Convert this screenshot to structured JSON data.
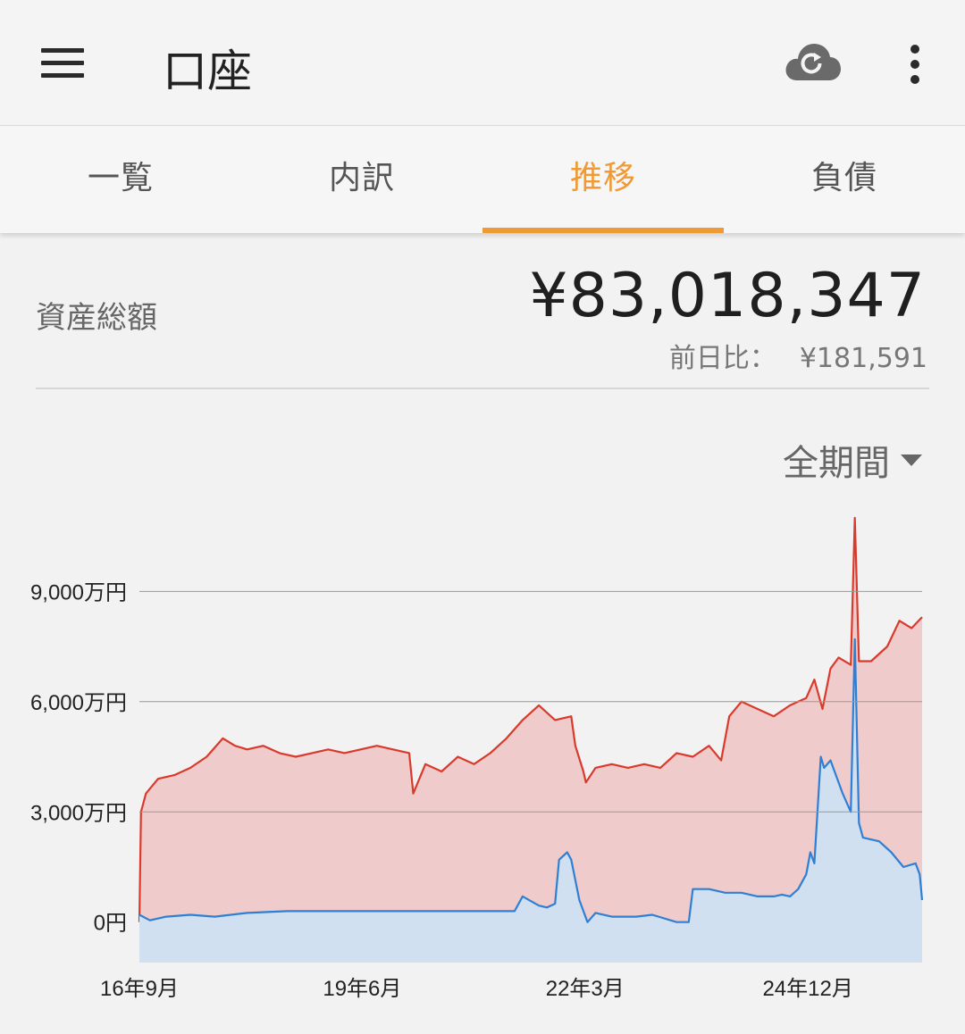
{
  "app_bar": {
    "title": "口座",
    "menu_icon": "hamburger-menu-icon",
    "sync_icon": "cloud-sync-icon",
    "more_icon": "more-vertical-icon"
  },
  "tabs": [
    {
      "label": "一覧",
      "active": false
    },
    {
      "label": "内訳",
      "active": false
    },
    {
      "label": "推移",
      "active": true
    },
    {
      "label": "負債",
      "active": false
    }
  ],
  "summary": {
    "total_label": "資産総額",
    "total_value": "¥83,018,347",
    "diff_label": "前日比：",
    "diff_value": "¥181,591"
  },
  "period": {
    "selected": "全期間"
  },
  "colors": {
    "accent": "#f09a36",
    "total_line": "#d93a2b",
    "total_fill": "#f0cbcb",
    "sub_line": "#2f7fd4",
    "sub_fill": "#d1e0f1"
  },
  "chart_data": {
    "type": "area",
    "ylabels": [
      "9,000万円",
      "6,000万円",
      "3,000万円",
      "0円"
    ],
    "yticks": [
      9000,
      6000,
      3000,
      0
    ],
    "ylim": [
      -1100,
      11000
    ],
    "xlabels": [
      "16年9月",
      "19年6月",
      "22年3月",
      "24年12月"
    ],
    "xticks": [
      2016.67,
      2019.42,
      2022.17,
      2024.92
    ],
    "xlim": [
      2016.67,
      2026.33
    ],
    "grid": true,
    "series": [
      {
        "key": "total",
        "x": [
          2016.67,
          2016.69,
          2016.75,
          2016.9,
          2017.1,
          2017.3,
          2017.5,
          2017.7,
          2017.85,
          2018.0,
          2018.2,
          2018.4,
          2018.6,
          2018.8,
          2019.0,
          2019.2,
          2019.4,
          2019.6,
          2019.8,
          2020.0,
          2020.05,
          2020.2,
          2020.4,
          2020.6,
          2020.8,
          2021.0,
          2021.2,
          2021.4,
          2021.6,
          2021.8,
          2022.0,
          2022.05,
          2022.15,
          2022.18,
          2022.3,
          2022.5,
          2022.7,
          2022.9,
          2023.1,
          2023.3,
          2023.5,
          2023.7,
          2023.85,
          2023.95,
          2024.1,
          2024.3,
          2024.5,
          2024.7,
          2024.9,
          2025.0,
          2025.1,
          2025.2,
          2025.3,
          2025.45,
          2025.5,
          2025.55,
          2025.7,
          2025.9,
          2026.05,
          2026.2,
          2026.33
        ],
        "y": [
          0,
          3000,
          3500,
          3900,
          4000,
          4200,
          4500,
          5000,
          4800,
          4700,
          4800,
          4600,
          4500,
          4600,
          4700,
          4600,
          4700,
          4800,
          4700,
          4600,
          3500,
          4300,
          4100,
          4500,
          4300,
          4600,
          5000,
          5500,
          5900,
          5500,
          5600,
          4800,
          4100,
          3800,
          4200,
          4300,
          4200,
          4300,
          4200,
          4600,
          4500,
          4800,
          4400,
          5600,
          6000,
          5800,
          5600,
          5900,
          6100,
          6600,
          5800,
          6900,
          7200,
          7000,
          11000,
          7100,
          7100,
          7500,
          8200,
          8000,
          8300
        ]
      },
      {
        "key": "sub",
        "x": [
          2016.67,
          2016.8,
          2017.0,
          2017.3,
          2017.6,
          2018.0,
          2018.5,
          2019.0,
          2019.5,
          2020.0,
          2020.5,
          2021.0,
          2021.3,
          2021.4,
          2021.6,
          2021.7,
          2021.8,
          2021.85,
          2021.95,
          2022.0,
          2022.1,
          2022.2,
          2022.3,
          2022.5,
          2022.8,
          2023.0,
          2023.3,
          2023.45,
          2023.5,
          2023.7,
          2023.9,
          2024.1,
          2024.3,
          2024.5,
          2024.6,
          2024.7,
          2024.8,
          2024.9,
          2024.95,
          2025.0,
          2025.08,
          2025.12,
          2025.2,
          2025.35,
          2025.45,
          2025.5,
          2025.55,
          2025.6,
          2025.8,
          2025.95,
          2026.1,
          2026.25,
          2026.3,
          2026.33
        ],
        "y": [
          200,
          50,
          150,
          200,
          150,
          250,
          300,
          300,
          300,
          300,
          300,
          300,
          300,
          700,
          450,
          400,
          500,
          1700,
          1900,
          1700,
          600,
          0,
          250,
          150,
          150,
          200,
          0,
          0,
          900,
          900,
          800,
          800,
          700,
          700,
          750,
          700,
          900,
          1300,
          1900,
          1600,
          4500,
          4200,
          4400,
          3500,
          3000,
          7700,
          2700,
          2300,
          2200,
          1900,
          1500,
          1600,
          1300,
          600
        ]
      }
    ]
  }
}
